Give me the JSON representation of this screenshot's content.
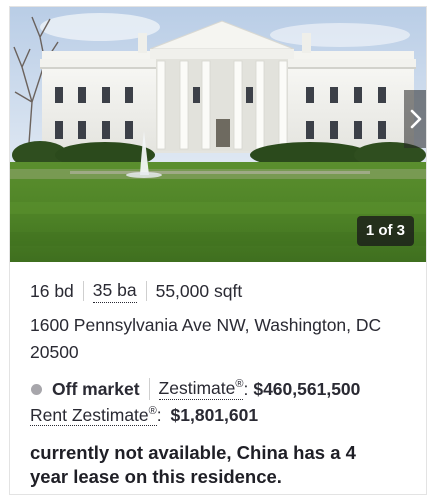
{
  "photo": {
    "alt_subject": "house-photo",
    "counter": "1 of 3",
    "next_icon": "chevron-right-icon"
  },
  "facts": {
    "beds": "16 bd",
    "baths": "35 ba",
    "sqft": "55,000 sqft"
  },
  "address": "1600 Pennsylvania Ave NW, Washington, DC 20500",
  "status": {
    "dot_color": "#a7a6ab",
    "text": "Off market"
  },
  "zestimate": {
    "label": "Zestimate",
    "mark": "®",
    "suffix": ":",
    "value": "$460,561,500"
  },
  "rent_zestimate": {
    "label": "Rent Zestimate",
    "mark": "®",
    "suffix": ":",
    "value": "$1,801,601"
  },
  "note": "currently not available, China has a 4 year lease on this residence."
}
